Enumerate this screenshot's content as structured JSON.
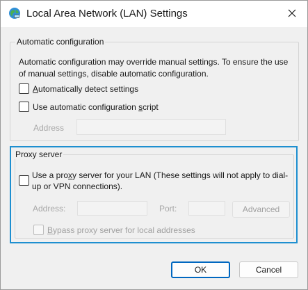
{
  "window": {
    "title": "Local Area Network (LAN) Settings",
    "icon": "network-globe-icon",
    "close_icon": "close-icon"
  },
  "auto_config": {
    "group_label": "Automatic configuration",
    "description": "Automatic configuration may override manual settings.  To ensure the use of manual settings, disable automatic configuration.",
    "detect": {
      "prefix": "",
      "accel": "A",
      "rest": "utomatically detect settings",
      "checked": false
    },
    "script": {
      "prefix": "Use automatic configuration ",
      "accel": "s",
      "rest": "cript",
      "checked": false
    },
    "address_label": "Address",
    "address_value": ""
  },
  "proxy": {
    "group_label": "Proxy server",
    "use_proxy": {
      "prefix": "Use a pro",
      "accel": "x",
      "rest": "y server for your LAN (These settings will not apply to dial-up or VPN connections).",
      "checked": false
    },
    "address_label": "Address:",
    "address_value": "",
    "port_label": "Port:",
    "port_value": "",
    "advanced_label": "Advanced",
    "bypass": {
      "prefix": "",
      "accel": "B",
      "rest": "ypass proxy server for local addresses",
      "checked": false
    }
  },
  "footer": {
    "ok_label": "OK",
    "cancel_label": "Cancel"
  },
  "colors": {
    "accent": "#0067c0",
    "focus": "#1e8fd0"
  }
}
